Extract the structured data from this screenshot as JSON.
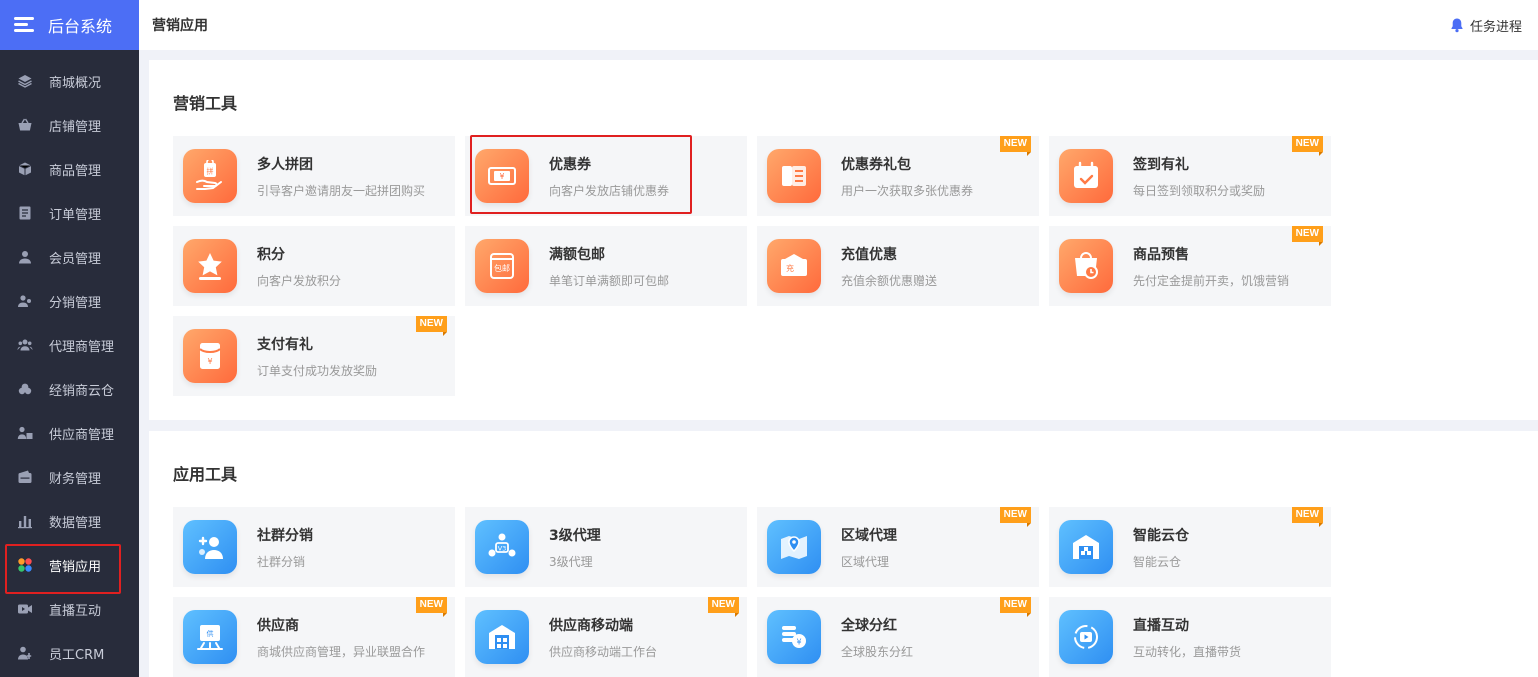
{
  "brand": {
    "title": "后台系统"
  },
  "sidebar": {
    "items": [
      {
        "label": "商城概况",
        "icon": "layers-icon"
      },
      {
        "label": "店铺管理",
        "icon": "basket-icon"
      },
      {
        "label": "商品管理",
        "icon": "cube-icon"
      },
      {
        "label": "订单管理",
        "icon": "document-icon"
      },
      {
        "label": "会员管理",
        "icon": "user-icon"
      },
      {
        "label": "分销管理",
        "icon": "users-share-icon"
      },
      {
        "label": "代理商管理",
        "icon": "group-icon"
      },
      {
        "label": "经销商云仓",
        "icon": "cloud-icon"
      },
      {
        "label": "供应商管理",
        "icon": "supplier-icon"
      },
      {
        "label": "财务管理",
        "icon": "wallet-icon"
      },
      {
        "label": "数据管理",
        "icon": "bar-chart-icon"
      },
      {
        "label": "营销应用",
        "icon": "apps-icon",
        "active": true
      },
      {
        "label": "直播互动",
        "icon": "video-icon"
      },
      {
        "label": "员工CRM",
        "icon": "staff-icon"
      }
    ]
  },
  "topbar": {
    "title": "营销应用",
    "task_label": "任务进程"
  },
  "marketing": {
    "title": "营销工具",
    "cards": [
      {
        "title": "多人拼团",
        "desc": "引导客户邀请朋友一起拼团购买",
        "new": false,
        "icon": "group-buy-icon"
      },
      {
        "title": "优惠券",
        "desc": "向客户发放店铺优惠券",
        "new": false,
        "icon": "coupon-icon",
        "highlight": true
      },
      {
        "title": "优惠券礼包",
        "desc": "用户一次获取多张优惠券",
        "new": true,
        "icon": "coupon-pack-icon"
      },
      {
        "title": "签到有礼",
        "desc": "每日签到领取积分或奖励",
        "new": true,
        "icon": "calendar-check-icon"
      },
      {
        "title": "积分",
        "desc": "向客户发放积分",
        "new": false,
        "icon": "star-icon"
      },
      {
        "title": "满额包邮",
        "desc": "单笔订单满额即可包邮",
        "new": false,
        "icon": "free-shipping-icon"
      },
      {
        "title": "充值优惠",
        "desc": "充值余额优惠赠送",
        "new": false,
        "icon": "recharge-icon"
      },
      {
        "title": "商品预售",
        "desc": "先付定金提前开卖，饥饿营销",
        "new": true,
        "icon": "presale-icon"
      },
      {
        "title": "支付有礼",
        "desc": "订单支付成功发放奖励",
        "new": true,
        "icon": "red-envelope-icon"
      }
    ]
  },
  "apps": {
    "title": "应用工具",
    "cards": [
      {
        "title": "社群分销",
        "desc": "社群分销",
        "new": false,
        "icon": "community-icon"
      },
      {
        "title": "3级代理",
        "desc": "3级代理",
        "new": false,
        "icon": "agent-v3-icon"
      },
      {
        "title": "区域代理",
        "desc": "区域代理",
        "new": true,
        "icon": "map-pin-icon"
      },
      {
        "title": "智能云仓",
        "desc": "智能云仓",
        "new": true,
        "icon": "warehouse-icon"
      },
      {
        "title": "供应商",
        "desc": "商城供应商管理，异业联盟合作",
        "new": true,
        "icon": "supplier-store-icon"
      },
      {
        "title": "供应商移动端",
        "desc": "供应商移动端工作台",
        "new": true,
        "icon": "mobile-warehouse-icon"
      },
      {
        "title": "全球分红",
        "desc": "全球股东分红",
        "new": true,
        "icon": "coins-icon"
      },
      {
        "title": "直播互动",
        "desc": "互动转化，直播带货",
        "new": false,
        "icon": "live-play-icon"
      }
    ]
  },
  "badge_label": "NEW",
  "colors": {
    "brand": "#4c6ef5",
    "sidebar": "#282c3b",
    "badge": "#ff9f1a",
    "highlight": "#e02020",
    "orange": "#ff6a3c",
    "blue": "#2f8ff2"
  }
}
